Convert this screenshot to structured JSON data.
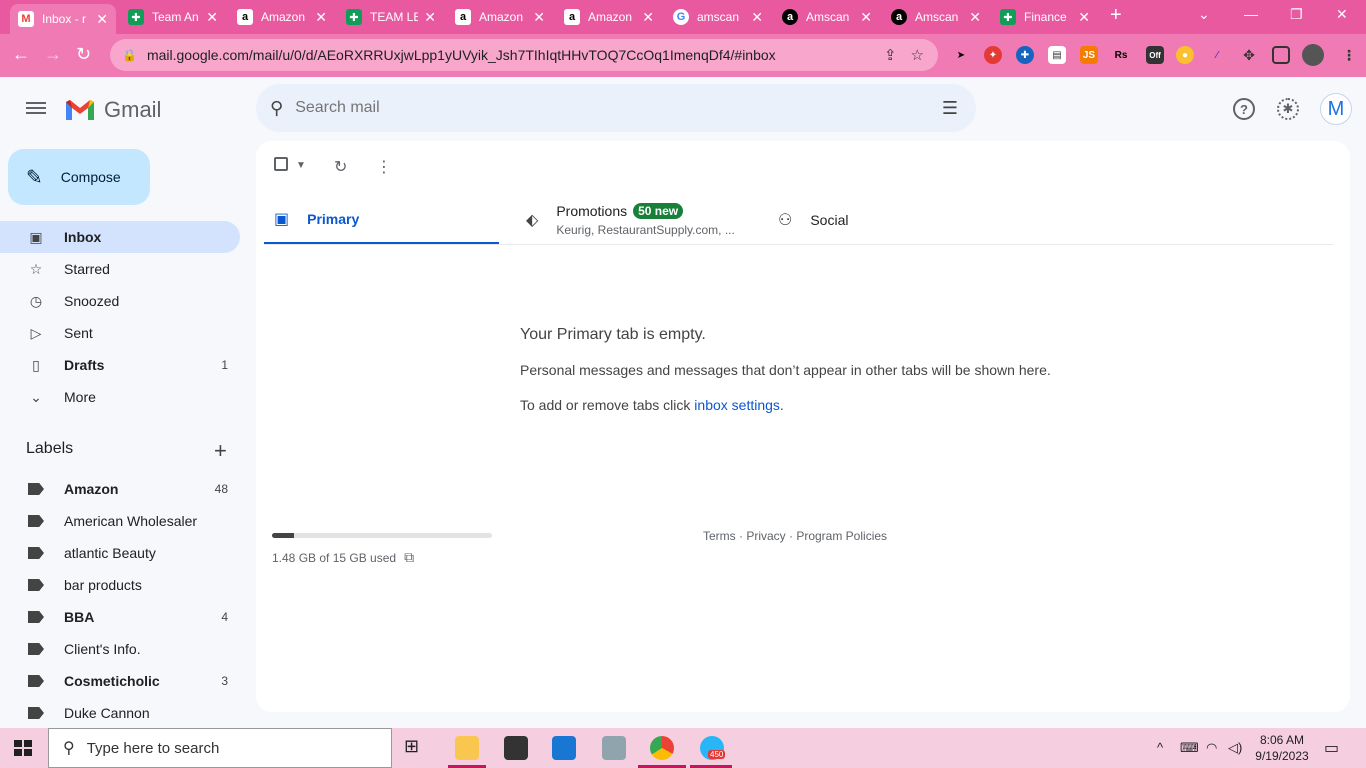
{
  "browser": {
    "tabs": [
      {
        "title": "Inbox - r",
        "favicon": "gmail",
        "glyph": "M"
      },
      {
        "title": "Team An",
        "favicon": "sheets",
        "glyph": "✚"
      },
      {
        "title": "Amazon",
        "favicon": "amazon",
        "glyph": "a"
      },
      {
        "title": "TEAM LE",
        "favicon": "sheets",
        "glyph": "✚"
      },
      {
        "title": "Amazon",
        "favicon": "amazon",
        "glyph": "a"
      },
      {
        "title": "Amazon",
        "favicon": "amazon",
        "glyph": "a"
      },
      {
        "title": "amscan",
        "favicon": "google",
        "glyph": "G"
      },
      {
        "title": "Amscan",
        "favicon": "amscan",
        "glyph": "a"
      },
      {
        "title": "Amscan",
        "favicon": "amscan",
        "glyph": "a"
      },
      {
        "title": "Finance",
        "favicon": "sheets",
        "glyph": "✚"
      }
    ],
    "url": "mail.google.com/mail/u/0/d/AEoRXRRUxjwLpp1yUVyik_Jsh7TIhIqtHHvTOQ7CcOq1ImenqDf4/#inbox",
    "new_tab_glyph": "+",
    "ext_icons": [
      "JS",
      "Rs",
      "Off"
    ]
  },
  "gmail": {
    "app_name": "Gmail",
    "search_placeholder": "Search mail",
    "avatar_letter": "M",
    "compose_label": "Compose",
    "nav": [
      {
        "label": "Inbox",
        "count": "",
        "icon": "inbox-icon"
      },
      {
        "label": "Starred",
        "count": "",
        "icon": "star-icon"
      },
      {
        "label": "Snoozed",
        "count": "",
        "icon": "clock-icon"
      },
      {
        "label": "Sent",
        "count": "",
        "icon": "send-icon"
      },
      {
        "label": "Drafts",
        "count": "1",
        "icon": "draft-icon"
      },
      {
        "label": "More",
        "count": "",
        "icon": "chevron-down-icon"
      }
    ],
    "labels_heading": "Labels",
    "labels": [
      {
        "label": "Amazon",
        "count": "48"
      },
      {
        "label": "American Wholesaler",
        "count": ""
      },
      {
        "label": "atlantic Beauty",
        "count": ""
      },
      {
        "label": "bar products",
        "count": ""
      },
      {
        "label": "BBA",
        "count": "4"
      },
      {
        "label": "Client's Info.",
        "count": ""
      },
      {
        "label": "Cosmeticholic",
        "count": "3"
      },
      {
        "label": "Duke Cannon",
        "count": ""
      }
    ],
    "tabs": {
      "primary": "Primary",
      "promotions": "Promotions",
      "promotions_badge": "50 new",
      "promotions_sub": "Keurig, RestaurantSupply.com, ...",
      "social": "Social"
    },
    "empty": {
      "title": "Your Primary tab is empty.",
      "line1": "Personal messages and messages that don’t appear in other tabs will be shown here.",
      "line2_prefix": "To add or remove tabs click ",
      "line2_link": "inbox settings",
      "line2_suffix": "."
    },
    "storage": {
      "text": "1.48 GB of 15 GB used",
      "fraction": 0.0987
    },
    "footer": "Terms · Privacy · Program Policies"
  },
  "taskbar": {
    "search_placeholder": "Type here to search",
    "time": "8:06 AM",
    "date": "9/19/2023",
    "telegram_badge": "450"
  },
  "colors": {
    "chrome_tab_bg": "#e8599f",
    "chrome_toolbar": "#f07ab3",
    "gmail_bg": "#f6f8fc",
    "selected_nav": "#d3e3fd",
    "compose": "#c2e7ff",
    "accent": "#0b57d0",
    "promo_badge": "#188038"
  }
}
